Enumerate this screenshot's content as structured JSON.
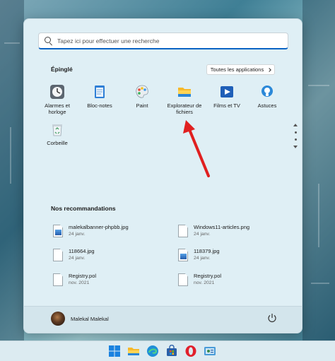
{
  "search": {
    "placeholder": "Tapez ici pour effectuer une recherche"
  },
  "pinned": {
    "title": "Épinglé",
    "all_apps_label": "Toutes les applications",
    "apps": [
      {
        "label": "Alarmes et horloge",
        "icon": "alarm-clock-icon"
      },
      {
        "label": "Bloc-notes",
        "icon": "notepad-icon"
      },
      {
        "label": "Paint",
        "icon": "paint-palette-icon"
      },
      {
        "label": "Explorateur de fichiers",
        "icon": "folder-icon"
      },
      {
        "label": "Films et TV",
        "icon": "films-tv-icon"
      },
      {
        "label": "Astuces",
        "icon": "tips-lightbulb-icon"
      },
      {
        "label": "Corbeille",
        "icon": "recycle-bin-icon"
      }
    ]
  },
  "recommendations": {
    "title": "Nos recommandations",
    "items": [
      {
        "name": "malekalbanner-phpbb.jpg",
        "date": "24 janv.",
        "icon": "image-file-icon"
      },
      {
        "name": "Windows11-articles.png",
        "date": "24 janv.",
        "icon": "blank-file-icon"
      },
      {
        "name": "118664.jpg",
        "date": "24 janv.",
        "icon": "blank-file-icon"
      },
      {
        "name": "118379.jpg",
        "date": "24 janv.",
        "icon": "image-file-icon"
      },
      {
        "name": "Registry.pol",
        "date": "nov. 2021",
        "icon": "blank-file-icon"
      },
      {
        "name": "Registry.pol",
        "date": "nov. 2021",
        "icon": "blank-file-icon"
      }
    ]
  },
  "user": {
    "name": "Malekal Malekal"
  },
  "taskbar": {
    "items": [
      "windows-start-icon",
      "file-explorer-icon",
      "edge-browser-icon",
      "microsoft-store-icon",
      "opera-icon",
      "control-panel-icon"
    ]
  },
  "colors": {
    "accent": "#0a63c4",
    "annotation_arrow": "#e02020",
    "menu_bg": "#dfeff5"
  }
}
